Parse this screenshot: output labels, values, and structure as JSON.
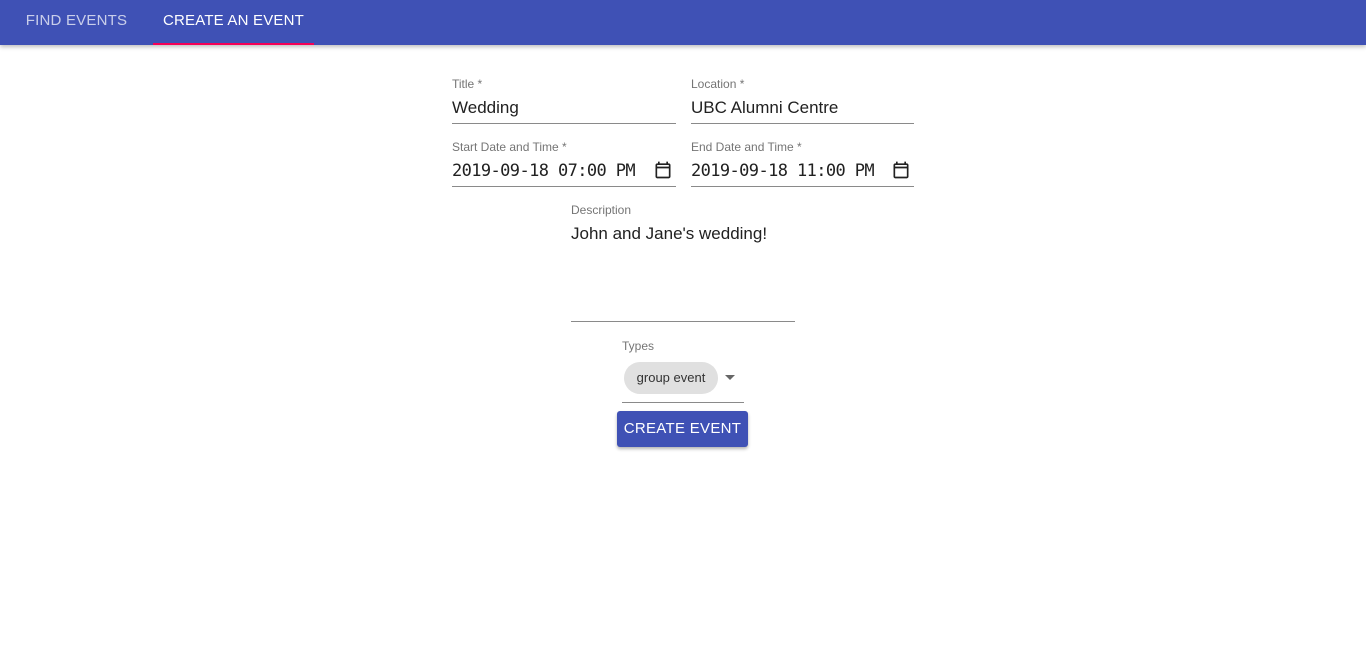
{
  "tabs": {
    "find_events": "FIND EVENTS",
    "create_event": "CREATE AN EVENT"
  },
  "form": {
    "title": {
      "label": "Title *",
      "value": "Wedding"
    },
    "location": {
      "label": "Location *",
      "value": "UBC Alumni Centre"
    },
    "start": {
      "label": "Start Date and Time *",
      "value": "2019-09-18 07:00 PM"
    },
    "end": {
      "label": "End Date and Time *",
      "value": "2019-09-18 11:00 PM"
    },
    "description": {
      "label": "Description",
      "value": "John and Jane's wedding!"
    },
    "types": {
      "label": "Types",
      "chip": "group event"
    },
    "submit_label": "CREATE EVENT"
  },
  "colors": {
    "primary": "#3f51b5",
    "tab_indicator": "#f50057",
    "chip_bg": "#e0e0e0"
  }
}
